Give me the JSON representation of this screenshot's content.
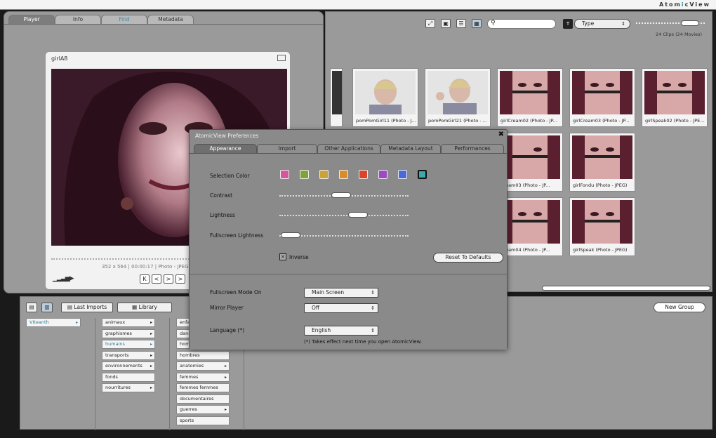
{
  "app": {
    "brand_prefix": "Atom",
    "brand_accent": "i",
    "brand_suffix": "cView"
  },
  "left": {
    "tabs": [
      {
        "label": "Player"
      },
      {
        "label": "Info"
      },
      {
        "label": "Find"
      },
      {
        "label": "Metadata"
      }
    ],
    "player": {
      "title": "girlA8",
      "meta": "352 x 564 | 00:00:17 | Photo - JPEG | 3",
      "controls": [
        "K",
        "<",
        ">",
        ">"
      ]
    }
  },
  "browser": {
    "search": {
      "placeholder": ""
    },
    "type_button": "T",
    "type_select": "Type",
    "clip_count": "24 Clips (24 Movies)",
    "thumbs_row1": [
      {
        "caption": "pomPomGirl11 (Photo - J..."
      },
      {
        "caption": "pomPomGirl21 (Photo - ..."
      },
      {
        "caption": "girlCream02 (Photo - JP..."
      },
      {
        "caption": "girlCream03 (Photo - JP..."
      },
      {
        "caption": "girlSpeak02 (Photo - JPE..."
      }
    ],
    "thumbs_row2": [
      {
        "caption": "Cream03 (Photo - JP..."
      },
      {
        "caption": "girlFondu (Photo - JPEG)"
      }
    ],
    "thumbs_row3": [
      {
        "caption": "Cream04 (Photo - JP..."
      },
      {
        "caption": "girlSpeak (Photo - JPEG)"
      }
    ]
  },
  "bottom": {
    "last_imports": "Last Imports",
    "library": "Library",
    "new_group": "New Group",
    "col1": [
      {
        "label": "VIteanth"
      }
    ],
    "col2": [
      {
        "label": "animaux"
      },
      {
        "label": "graphismes"
      },
      {
        "label": "humains"
      },
      {
        "label": "transports"
      },
      {
        "label": "environnements"
      },
      {
        "label": "fonds"
      },
      {
        "label": "nourritures"
      }
    ],
    "col3": [
      {
        "label": "enfa"
      },
      {
        "label": "dans"
      },
      {
        "label": "hom"
      },
      {
        "label": "hombres"
      },
      {
        "label": "anatomies"
      },
      {
        "label": "femmes"
      },
      {
        "label": "femmes femmes"
      },
      {
        "label": "documentaires"
      },
      {
        "label": "guerres"
      },
      {
        "label": "sports"
      }
    ]
  },
  "prefs": {
    "title": "AtomicView Preferences",
    "tabs": [
      {
        "label": "Appearance"
      },
      {
        "label": "Import"
      },
      {
        "label": "Other Applications"
      },
      {
        "label": "Metadata Layout"
      },
      {
        "label": "Performances"
      }
    ],
    "selection_color_label": "Selection Color",
    "swatches": [
      "#d4569b",
      "#7fa33a",
      "#c9a23a",
      "#d98c2a",
      "#d9442a",
      "#9c4ac4",
      "#4a6ad9",
      "#3ba8ae"
    ],
    "contrast_label": "Contrast",
    "lightness_label": "Lightness",
    "fullscreen_lightness_label": "Fullscreen Lightness",
    "inverse_label": "Inverse",
    "reset_label": "Reset To Defaults",
    "fullscreen_mode_label": "Fullscreen Mode On",
    "fullscreen_mode_value": "Main Screen",
    "mirror_label": "Mirror Player",
    "mirror_value": "Off",
    "language_label": "Language (*)",
    "language_value": "English",
    "note": "(*) Takes effect next time you open AtomicView."
  }
}
